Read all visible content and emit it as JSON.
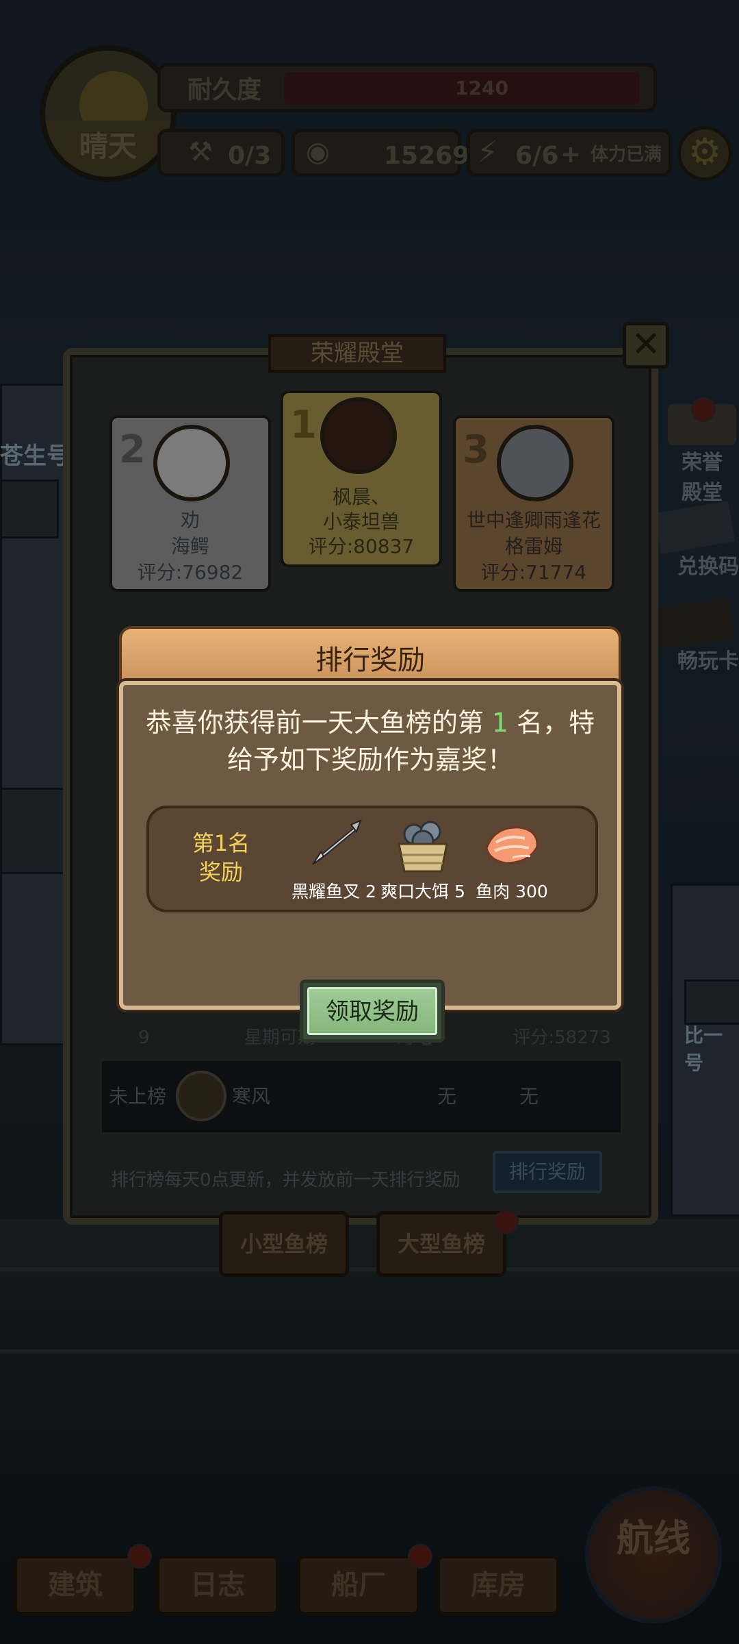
{
  "hud": {
    "weather": "晴天",
    "durability_label": "耐久度",
    "durability_value": "1240",
    "hammer_count": "0/3",
    "coins": "15269",
    "energy": "6/6",
    "energy_note": "体力已满"
  },
  "side_icons": [
    "荣誉殿堂",
    "兑换码",
    "畅玩卡"
  ],
  "bg_signs": [
    "苍生号",
    "比一号"
  ],
  "hall": {
    "title": "荣耀殿堂",
    "podium": [
      {
        "rank": "2",
        "name1": "劝",
        "name2": "海鳄",
        "score": "评分:76982"
      },
      {
        "rank": "1",
        "name1": "枫晨、",
        "name2": "小泰坦兽",
        "score": "评分:80837"
      },
      {
        "rank": "3",
        "name1": "世中逢卿雨逢花",
        "name2": "格雷姆",
        "score": "评分:71774"
      }
    ],
    "hidden_row": {
      "rank": "9",
      "name": "星期可期",
      "fish": "海龟",
      "score": "评分:58273"
    },
    "my_row": {
      "status": "未上榜",
      "name": "寒风",
      "fish": "无",
      "score": "无"
    },
    "note": "排行榜每天0点更新，并发放前一天排行奖励",
    "rank_reward_btn": "排行奖励",
    "tabs": [
      "小型鱼榜",
      "大型鱼榜"
    ]
  },
  "dialog": {
    "title": "排行奖励",
    "line1_pre": "恭喜你获得前一天大鱼榜的第 ",
    "line1_rank": "1",
    "line1_post": " 名，特",
    "line2": "给予如下奖励作为嘉奖！",
    "reward_label_1": "第1名",
    "reward_label_2": "奖励",
    "rewards": [
      {
        "name": "黑耀鱼叉 2",
        "icon": "harpoon-icon"
      },
      {
        "name": "爽口大饵 5",
        "icon": "bait-basket-icon"
      },
      {
        "name": "鱼肉 300",
        "icon": "fish-meat-icon"
      }
    ],
    "claim": "领取奖励"
  },
  "nav": [
    "建筑",
    "日志",
    "船厂",
    "库房"
  ],
  "route": "航线"
}
